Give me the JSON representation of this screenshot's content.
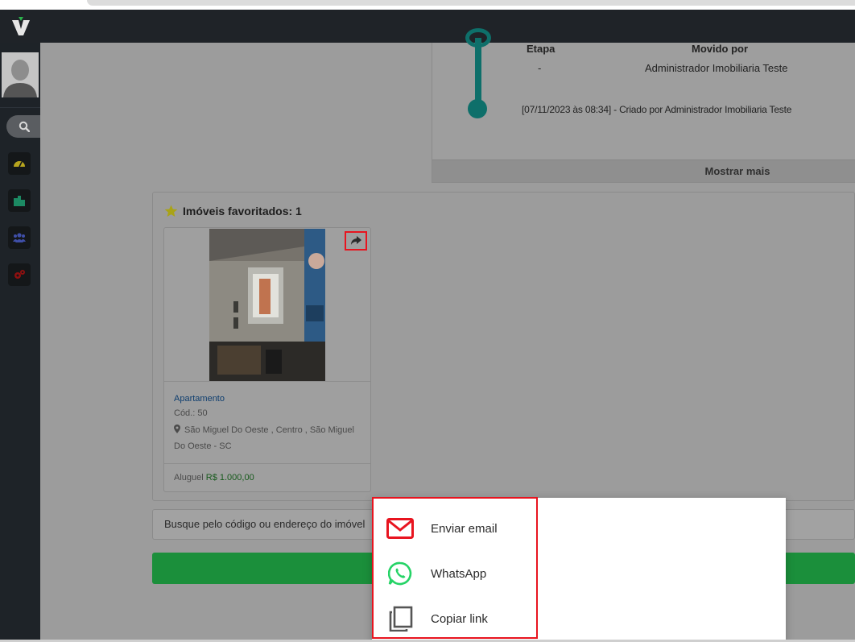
{
  "history": {
    "headers": {
      "stage": "Etapa",
      "moved_by": "Movido por"
    },
    "row": {
      "stage": "-",
      "moved_by": "Administrador Imobiliaria Teste"
    },
    "log": "[07/11/2023 às 08:34] - Criado por Administrador Imobiliaria Teste",
    "show_more": "Mostrar mais"
  },
  "favorites": {
    "title": "Imóveis favoritados: 1",
    "card": {
      "type": "Apartamento",
      "code": "Cód.: 50",
      "address": "São Miguel Do Oeste , Centro , São Miguel Do Oeste - SC",
      "rent_label": "Aluguel",
      "rent_value": "R$  1.000,00"
    }
  },
  "search": {
    "placeholder": "Busque pelo código ou endereço do imóvel"
  },
  "share_menu": {
    "items": [
      {
        "label": "Enviar email",
        "icon": "envelope-icon"
      },
      {
        "label": "WhatsApp",
        "icon": "whatsapp-icon"
      },
      {
        "label": "Copiar link",
        "icon": "copy-icon"
      }
    ]
  },
  "colors": {
    "topbar": "#1f2328",
    "timeline": "#0e6f6a",
    "highlight": "#e8141f",
    "primary_button": "#1b8f3b",
    "email_icon": "#e8141f",
    "whatsapp_icon": "#25d366"
  },
  "icons": {
    "sidebar": [
      "search-icon",
      "dashboard-gauge-icon",
      "buildings-icon",
      "users-icon",
      "settings-gears-icon"
    ],
    "share": "share-arrow-icon",
    "star": "star-icon",
    "map_marker": "map-marker-icon"
  }
}
